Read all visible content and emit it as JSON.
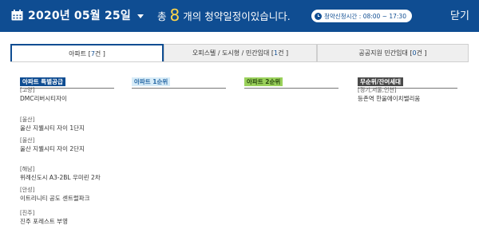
{
  "header": {
    "date": "2020년 05월 25일",
    "summary_prefix": "총",
    "count": "8",
    "summary_suffix": "개의 청약일정이있습니다.",
    "time_label": "청약신청시간 : 08:00 ~ 17:30",
    "close_label": "닫기"
  },
  "tabs": [
    {
      "label": "아파트 [ ",
      "count": "7",
      "unit": "건 ]",
      "active": true
    },
    {
      "label": "오피스텔 / 도시형 / 민간임대 [ ",
      "count": "1",
      "unit": "건 ]",
      "active": false
    },
    {
      "label": "공공지원 민간임대 [ ",
      "count": "0",
      "unit": "건 ]",
      "active": false
    }
  ],
  "columns": [
    {
      "title": "아파트 특별공급",
      "items": [
        {
          "region": "[고양]",
          "name": "DMC리버시티자이"
        },
        {
          "region": "[울산]",
          "name": "울산 지웰시티 자이 1단지"
        },
        {
          "region": "[울산]",
          "name": "울산 지웰시티 자이 2단지"
        },
        {
          "region": "[해남]",
          "name": "위례신도시 A3-2BL 우미린 2차"
        },
        {
          "region": "[안성]",
          "name": "이트리니티 공도 센트럴파크"
        },
        {
          "region": "[진주]",
          "name": "진주 포레스트 부영"
        }
      ]
    },
    {
      "title": "아파트 1순위",
      "items": []
    },
    {
      "title": "아파트 2순위",
      "items": []
    },
    {
      "title": "무순위/잔여세대",
      "items": [
        {
          "region": "[경기,서울,인천]",
          "name": "등촌역 한울에이치밸리움"
        }
      ]
    }
  ],
  "colors": {
    "header_bg": "#0f4d92",
    "count_accent": "#ffd54a",
    "rank2_bg": "#9ad15b",
    "rank1_bg": "#d7ecf8"
  },
  "icons": {
    "date": "calendar-icon",
    "time": "clock-icon",
    "dropdown": "caret-down-icon"
  }
}
